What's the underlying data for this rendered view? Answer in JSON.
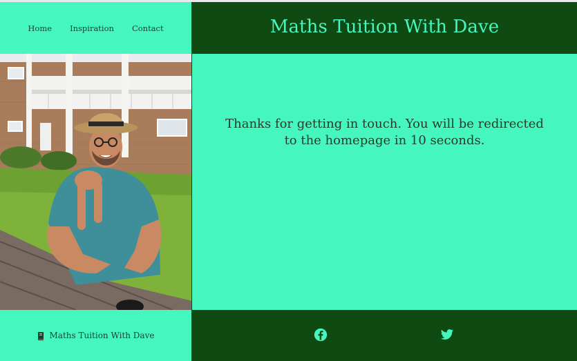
{
  "nav": {
    "items": [
      {
        "label": "Home"
      },
      {
        "label": "Inspiration"
      },
      {
        "label": "Contact"
      }
    ]
  },
  "header": {
    "title": "Maths Tuition With Dave"
  },
  "main": {
    "message": "Thanks for getting in touch. You will be redirected to the homepage in 10 seconds."
  },
  "footer": {
    "brand_label": "Maths Tuition With Dave",
    "brand_icon": "book-icon",
    "social": [
      {
        "icon": "facebook-icon"
      },
      {
        "icon": "twitter-icon"
      }
    ]
  },
  "colors": {
    "mint": "#45f7bf",
    "dark_green": "#0e4a12",
    "text": "#1f3d2b"
  }
}
